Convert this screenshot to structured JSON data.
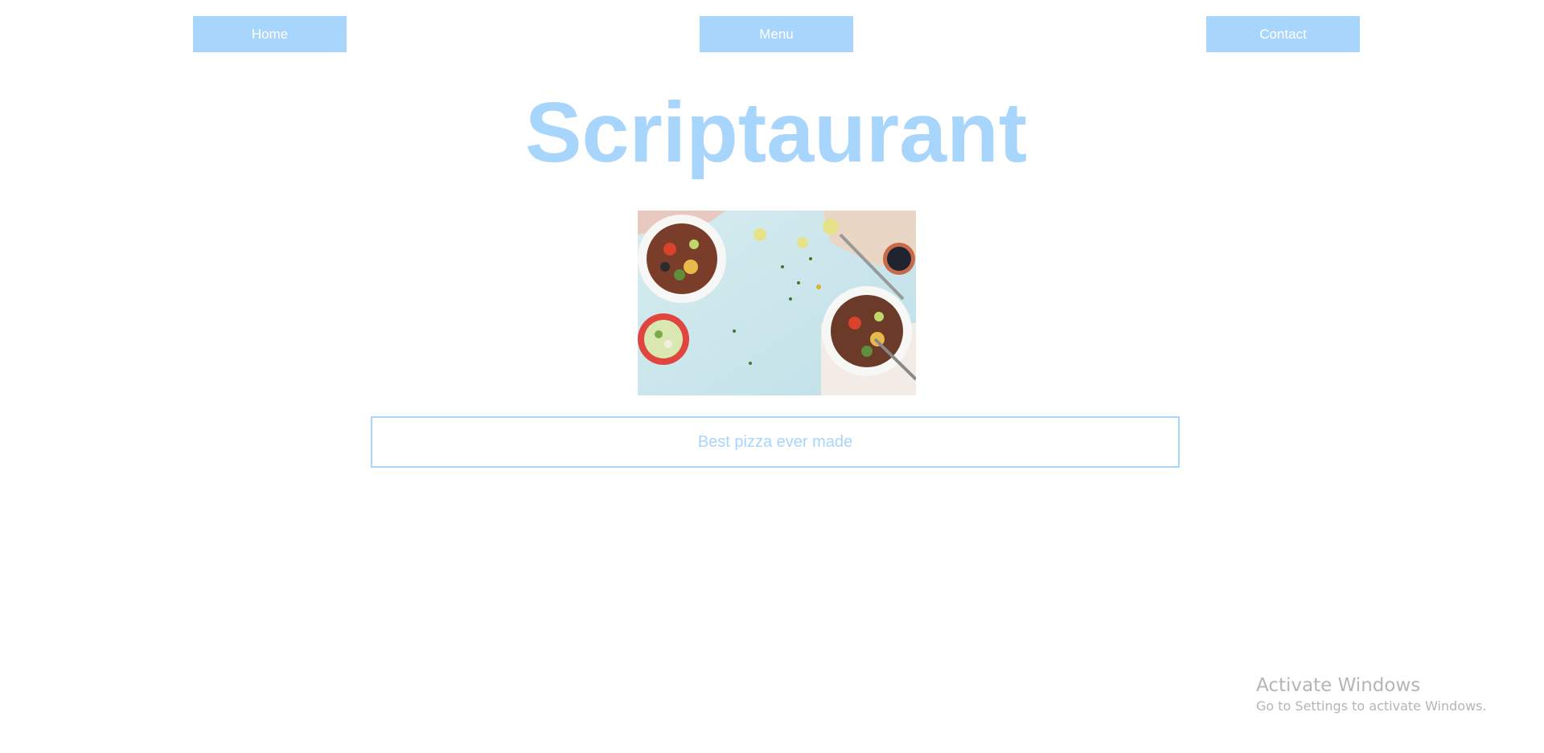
{
  "nav": {
    "home_label": "Home",
    "menu_label": "Menu",
    "contact_label": "Contact"
  },
  "header": {
    "title": "Scriptaurant"
  },
  "hero": {
    "image_alt": "Top-down view of salad bowls on a light blue table"
  },
  "tagline": {
    "text": "Best pizza ever made"
  },
  "watermark": {
    "title": "Activate Windows",
    "subtitle": "Go to Settings to activate Windows."
  },
  "colors": {
    "accent": "#a8d5fc",
    "background": "#ffffff",
    "watermark_text": "#b5b5b5"
  }
}
